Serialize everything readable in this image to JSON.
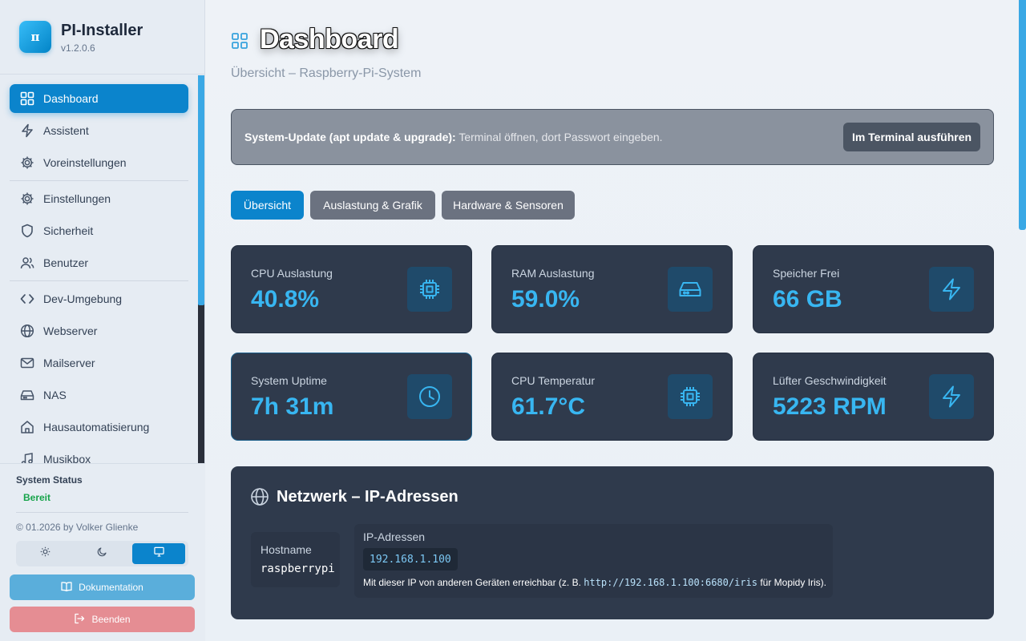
{
  "app": {
    "title": "PI-Installer",
    "version": "v1.2.0.6",
    "logo_glyph": "π"
  },
  "sidebar": {
    "items": [
      {
        "label": "Dashboard",
        "icon": "grid-icon",
        "active": true
      },
      {
        "label": "Assistent",
        "icon": "lightning-icon"
      },
      {
        "label": "Voreinstellungen",
        "icon": "gear-icon"
      },
      {
        "label": "Einstellungen",
        "icon": "gear-icon"
      },
      {
        "label": "Sicherheit",
        "icon": "shield-icon"
      },
      {
        "label": "Benutzer",
        "icon": "users-icon"
      },
      {
        "label": "Dev-Umgebung",
        "icon": "code-icon"
      },
      {
        "label": "Webserver",
        "icon": "globe-icon"
      },
      {
        "label": "Mailserver",
        "icon": "mail-icon"
      },
      {
        "label": "NAS",
        "icon": "drive-icon"
      },
      {
        "label": "Hausautomatisierung",
        "icon": "home-icon"
      },
      {
        "label": "Musikbox",
        "icon": "music-icon"
      }
    ],
    "status_label": "System Status",
    "status_value": "Bereit",
    "copyright": "© 01.2026 by Volker Glienke",
    "theme_options": [
      "light",
      "dark",
      "system"
    ],
    "theme_selected": "system",
    "docs_label": "Dokumentation",
    "quit_label": "Beenden"
  },
  "header": {
    "title": "Dashboard",
    "subtitle": "Übersicht – Raspberry-Pi-System"
  },
  "update_banner": {
    "bold": "System-Update (apt update & upgrade):",
    "text": " Terminal öffnen, dort Passwort eingeben.",
    "button": "Im Terminal ausführen"
  },
  "tabs": [
    {
      "label": "Übersicht",
      "active": true
    },
    {
      "label": "Auslastung & Grafik",
      "active": false
    },
    {
      "label": "Hardware & Sensoren",
      "active": false
    }
  ],
  "cards": [
    {
      "label": "CPU Auslastung",
      "value": "40.8%",
      "icon": "cpu-icon"
    },
    {
      "label": "RAM Auslastung",
      "value": "59.0%",
      "icon": "drive-icon"
    },
    {
      "label": "Speicher Frei",
      "value": "66 GB",
      "icon": "lightning-icon"
    },
    {
      "label": "System Uptime",
      "value": "7h 31m",
      "icon": "clock-icon"
    },
    {
      "label": "CPU Temperatur",
      "value": "61.7°C",
      "icon": "cpu-icon"
    },
    {
      "label": "Lüfter Geschwindigkeit",
      "value": "5223 RPM",
      "icon": "lightning-icon"
    }
  ],
  "network": {
    "title": "Netzwerk – IP-Adressen",
    "hostname_label": "Hostname",
    "hostname": "raspberrypi",
    "ip_label": "IP-Adressen",
    "ip": "192.168.1.100",
    "note_prefix": "Mit dieser IP von anderen Geräten erreichbar (z. B. ",
    "note_url": "http://192.168.1.100:6680/iris",
    "note_suffix": " für Mopidy Iris)."
  },
  "colors": {
    "accent": "#0b84cc",
    "card_bg": "#2f3a4c",
    "value": "#38b6f1",
    "status_ok": "#16a34a"
  }
}
